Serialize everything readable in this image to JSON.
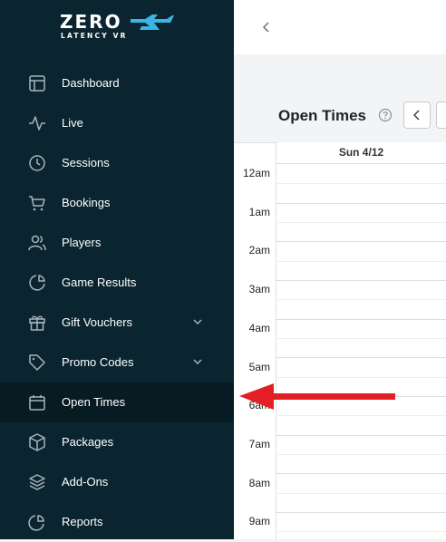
{
  "logo": {
    "main": "ZERO",
    "sub": "LATENCY VR"
  },
  "sidebar": {
    "items": [
      {
        "label": "Dashboard",
        "icon": "dashboard-icon"
      },
      {
        "label": "Live",
        "icon": "pulse-icon"
      },
      {
        "label": "Sessions",
        "icon": "clock-icon"
      },
      {
        "label": "Bookings",
        "icon": "cart-icon"
      },
      {
        "label": "Players",
        "icon": "users-icon"
      },
      {
        "label": "Game Results",
        "icon": "pie-chart-icon"
      },
      {
        "label": "Gift Vouchers",
        "icon": "gift-icon",
        "expandable": true
      },
      {
        "label": "Promo Codes",
        "icon": "tag-icon",
        "expandable": true
      },
      {
        "label": "Open Times",
        "icon": "calendar-icon",
        "active": true
      },
      {
        "label": "Packages",
        "icon": "box-icon"
      },
      {
        "label": "Add-Ons",
        "icon": "layers-icon"
      },
      {
        "label": "Reports",
        "icon": "report-icon"
      }
    ]
  },
  "main": {
    "title": "Open Times",
    "day_header": "Sun 4/12",
    "hours": [
      "12am",
      "1am",
      "2am",
      "3am",
      "4am",
      "5am",
      "6am",
      "7am",
      "8am",
      "9am"
    ]
  },
  "colors": {
    "sidebar": "#0b2530",
    "active": "#071b23",
    "arrow": "#e31e24"
  }
}
